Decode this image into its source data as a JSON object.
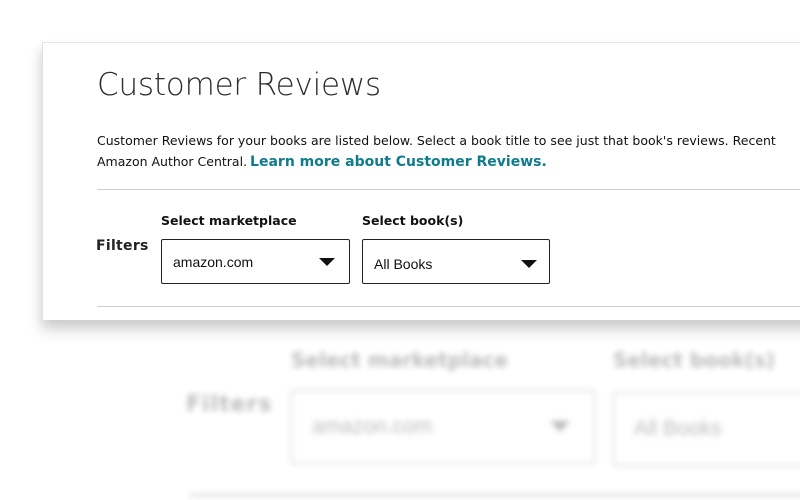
{
  "page": {
    "title": "Customer Reviews",
    "intro_line1": "Customer Reviews for your books are listed below. Select a book title to see just that book's reviews. Recent",
    "intro_line2": "Amazon Author Central.",
    "learn_more_link": "Learn more about Customer Reviews."
  },
  "filters": {
    "label": "Filters",
    "marketplace": {
      "label": "Select marketplace",
      "selected": "amazon.com"
    },
    "books": {
      "label": "Select book(s)",
      "selected": "All Books"
    }
  },
  "icons": {
    "dropdown": "caret-down-icon"
  },
  "colors": {
    "link": "#0e7c8c",
    "text": "#111111",
    "title": "#2b2b2b"
  }
}
